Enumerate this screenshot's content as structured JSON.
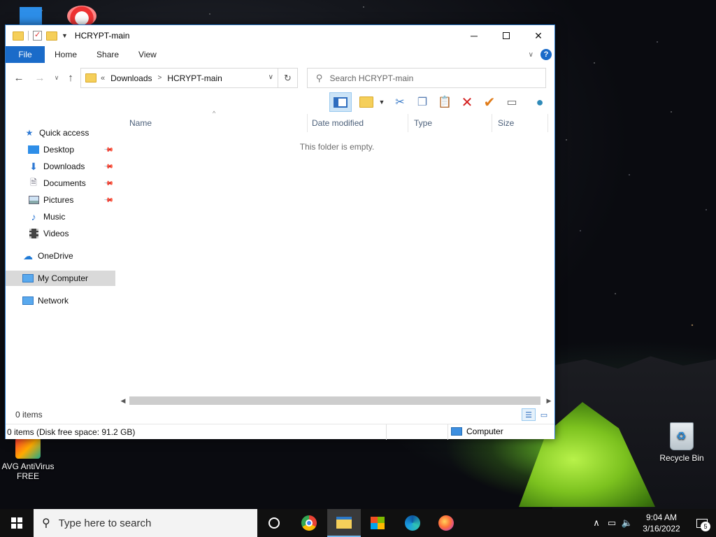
{
  "window": {
    "title": "HCRYPT-main",
    "ribbon_tabs": [
      "File",
      "Home",
      "Share",
      "View"
    ],
    "address": {
      "overflow": "«",
      "crumbs": [
        "Downloads",
        "HCRYPT-main"
      ]
    },
    "search_placeholder": "Search HCRYPT-main",
    "nav": {
      "quick_access": "Quick access",
      "items": [
        "Desktop",
        "Downloads",
        "Documents",
        "Pictures",
        "Music",
        "Videos"
      ],
      "onedrive": "OneDrive",
      "my_computer": "My Computer",
      "network": "Network"
    },
    "columns": [
      "Name",
      "Date modified",
      "Type",
      "Size"
    ],
    "empty_message": "This folder is empty.",
    "item_count": "0 items",
    "status": {
      "left": "0 items (Disk free space: 91.2 GB)",
      "right": "Computer"
    }
  },
  "desktop": {
    "icons": [
      {
        "label": "AVG AntiVirus FREE",
        "icon": "avg-icon"
      },
      {
        "label": "Recycle Bin",
        "icon": "recycle-bin-icon"
      }
    ]
  },
  "taskbar": {
    "search_placeholder": "Type here to search",
    "apps": [
      "cortana-icon",
      "chrome-icon",
      "file-explorer-icon",
      "store-icon",
      "edge-icon",
      "firefox-icon"
    ],
    "time": "9:04 AM",
    "date": "3/16/2022",
    "notification_count": "5"
  },
  "colors": {
    "accent": "#1a6bc9",
    "selection": "#cce4f7",
    "taskbar": "#101010"
  }
}
